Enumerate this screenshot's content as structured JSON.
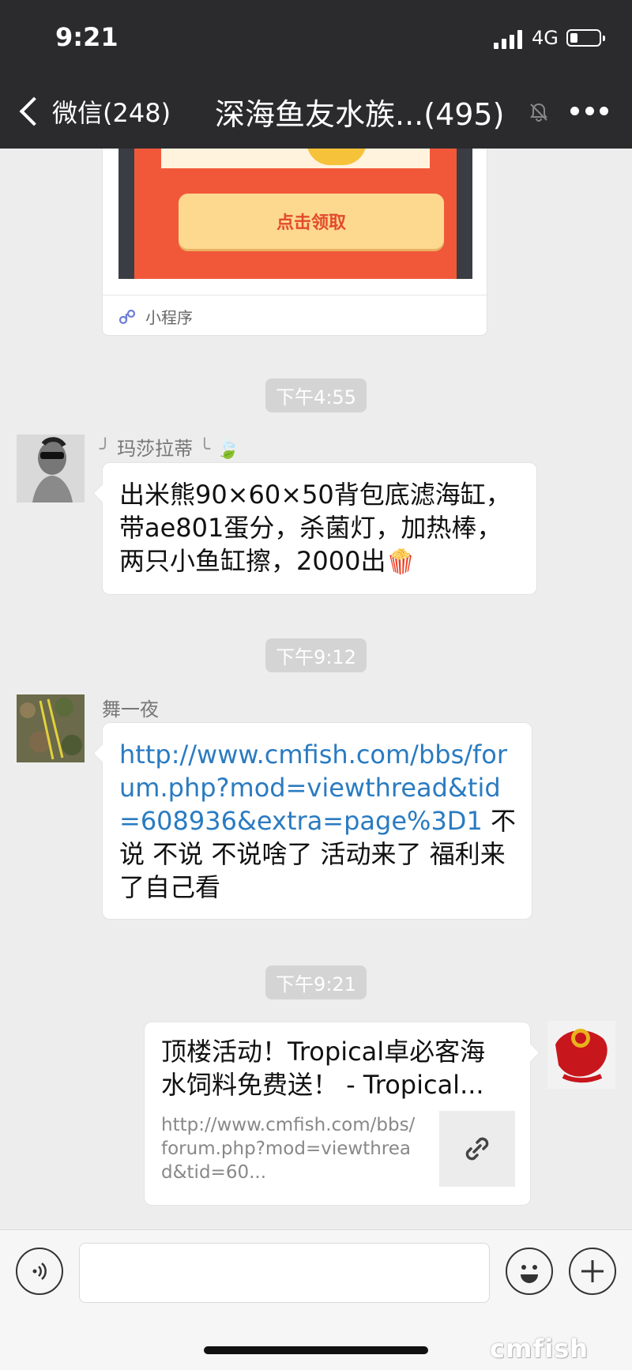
{
  "status_bar": {
    "time": "9:21",
    "network": "4G"
  },
  "nav": {
    "back_label": "微信(248)",
    "title": "深海鱼友水族...(495)"
  },
  "mini_program": {
    "button_label": "点击领取",
    "footer_label": "小程序"
  },
  "messages": [
    {
      "timestamp": "下午4:55",
      "sender": "玛莎拉蒂",
      "text": "出米熊90×60×50背包底滤海缸，带ae801蛋分，杀菌灯，加热棒，两只小鱼缸擦，2000出"
    },
    {
      "timestamp": "下午9:12",
      "sender": "舞一夜",
      "link": "http://www.cmfish.com/bbs/forum.php?mod=viewthread&tid=608936&extra=page%3D1",
      "text": " 不说 不说  不说啥了 活动来了 福利来了自己看"
    },
    {
      "timestamp": "下午9:21",
      "card_title": "顶楼活动！Tropical卓必客海水饲料免费送！ - Tropical...",
      "card_url": "http://www.cmfish.com/bbs/forum.php?mod=viewthread&tid=60..."
    }
  ],
  "input": {
    "placeholder": ""
  },
  "watermark": "cmfish",
  "icons": {
    "signal": "signal-icon",
    "battery": "battery-icon",
    "mute": "mute-icon",
    "more": "more-icon",
    "mini_program": "mini-program-icon",
    "emoji": "popcorn-emoji-icon",
    "link": "link-icon",
    "voice": "voice-icon",
    "smiley": "smiley-icon",
    "plus": "plus-icon"
  },
  "colors": {
    "nav_bg": "#2b2b2e",
    "chat_bg": "#ededed",
    "link": "#2a7bc1",
    "claim_button": "#fdd98f",
    "red_packet": "#f1583a"
  }
}
